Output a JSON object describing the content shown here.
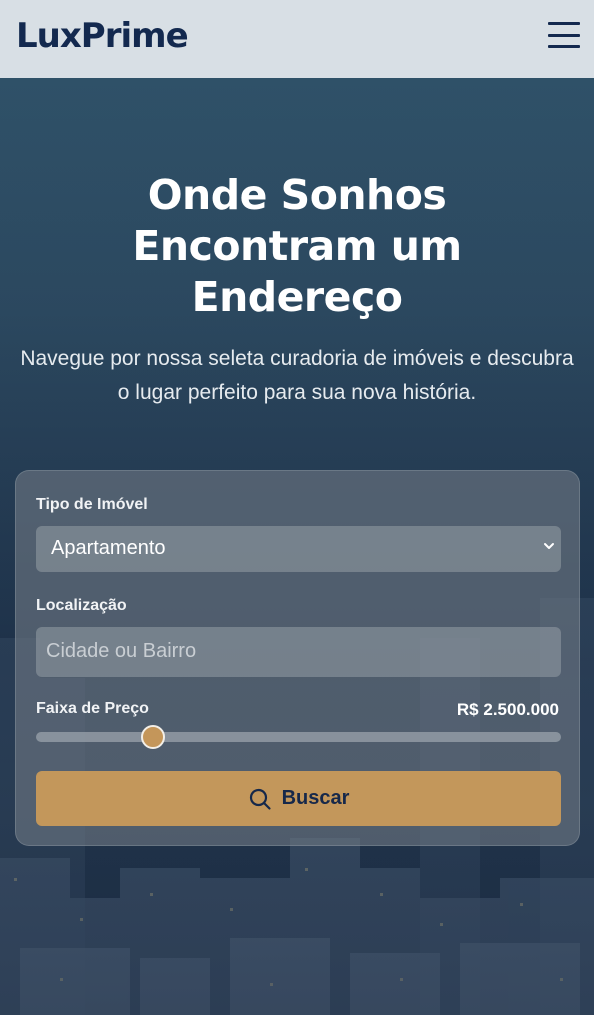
{
  "header": {
    "logo": "LuxPrime",
    "menu_icon": "hamburger-menu-icon"
  },
  "hero": {
    "title": "Onde Sonhos Encontram um Endereço",
    "subtitle": "Navegue por nossa seleta curadoria de imóveis e descubra o lugar perfeito para sua nova história."
  },
  "search": {
    "property_type_label": "Tipo de Imóvel",
    "property_type_value": "Apartamento",
    "location_label": "Localização",
    "location_placeholder": "Cidade ou Bairro",
    "price_label": "Faixa de Preço",
    "price_value": "R$ 2.500.000",
    "price_slider_fraction": 0.223,
    "button_label": "Buscar",
    "button_icon": "search-icon"
  },
  "colors": {
    "brand_navy": "#13294f",
    "accent_gold": "#c3975b",
    "header_bg": "#d8dfe5"
  }
}
